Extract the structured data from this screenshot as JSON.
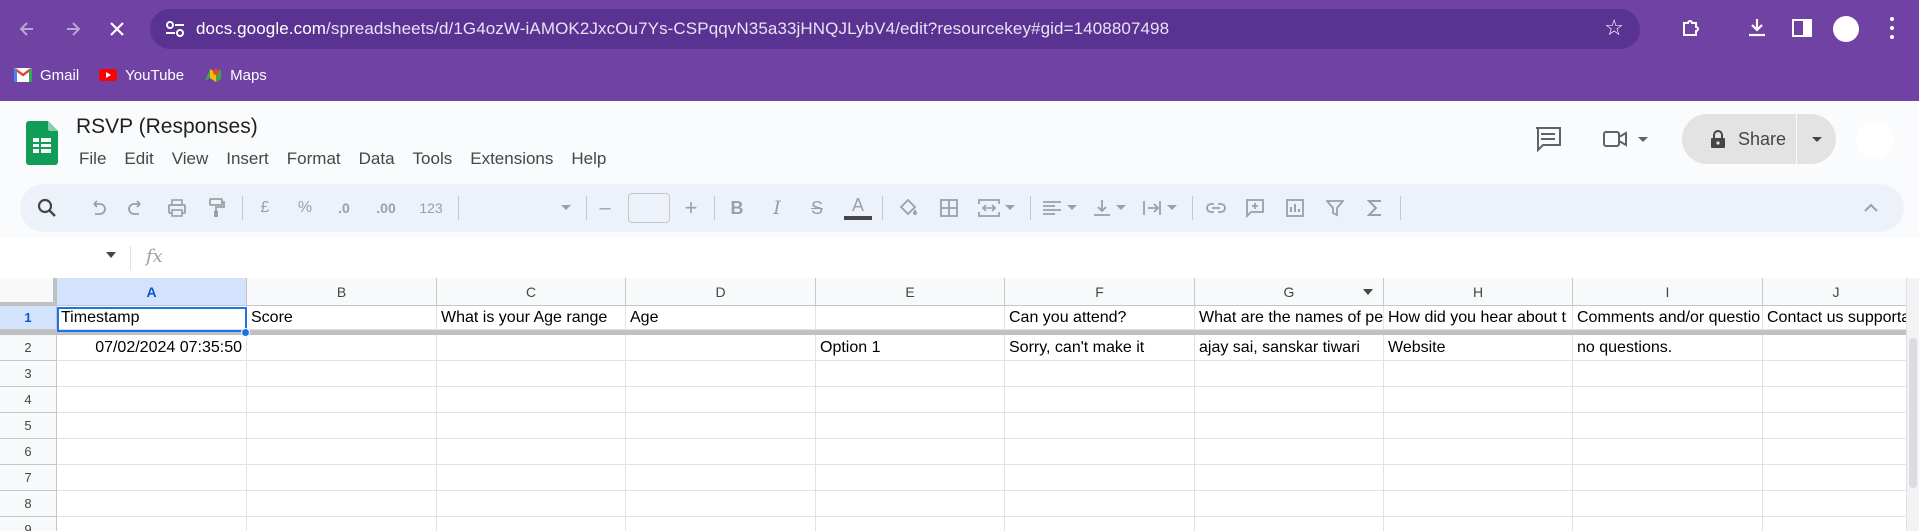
{
  "browser": {
    "url_host": "docs.google.com",
    "url_path": "/spreadsheets/d/1G4ozW-iAMOK2JxcOu7Ys-CSPqqvN35a33jHNQJLybV4/edit?resourcekey#gid=1408807498",
    "bookmarks": [
      {
        "label": "Gmail",
        "icon": "gmail-icon",
        "color": "#ea4335"
      },
      {
        "label": "YouTube",
        "icon": "youtube-icon",
        "color": "#ff0000"
      },
      {
        "label": "Maps",
        "icon": "maps-icon",
        "color": "#34a853"
      }
    ],
    "colors": {
      "frame": "#6f42a4",
      "omnibox": "#5a3392"
    }
  },
  "doc": {
    "title": "RSVP (Responses)",
    "menu": [
      "File",
      "Edit",
      "View",
      "Insert",
      "Format",
      "Data",
      "Tools",
      "Extensions",
      "Help"
    ],
    "share_label": "Share",
    "accent": "#0b57d0"
  },
  "toolbar": {
    "currency": "£",
    "percent": "%",
    "dec_decrease": ".0",
    "dec_increase": ".00",
    "number_format": "123",
    "font_size_minus": "–",
    "font_size_plus": "+",
    "bold": "B",
    "italic": "I",
    "strike": "S",
    "text_color": "A"
  },
  "formula_bar": {
    "fx": "fx"
  },
  "grid": {
    "columns": [
      "A",
      "B",
      "C",
      "D",
      "E",
      "F",
      "G",
      "H",
      "I",
      "J"
    ],
    "rows": [
      "1",
      "2",
      "3",
      "4",
      "5",
      "6",
      "7",
      "8",
      "9"
    ],
    "header_row": [
      "Timestamp",
      "Score",
      "What is your Age range",
      "Age",
      "",
      "Can you attend?",
      "What are the names of pe",
      "How did you hear about t",
      "Comments and/or questio",
      "Contact us supporta"
    ],
    "data_rows": [
      [
        "07/02/2024 07:35:50",
        "",
        "",
        "",
        "Option 1",
        "Sorry, can't make it",
        "ajay sai, sanskar tiwari",
        "Website",
        "no questions.",
        ""
      ]
    ],
    "selected_cell": "A1"
  }
}
